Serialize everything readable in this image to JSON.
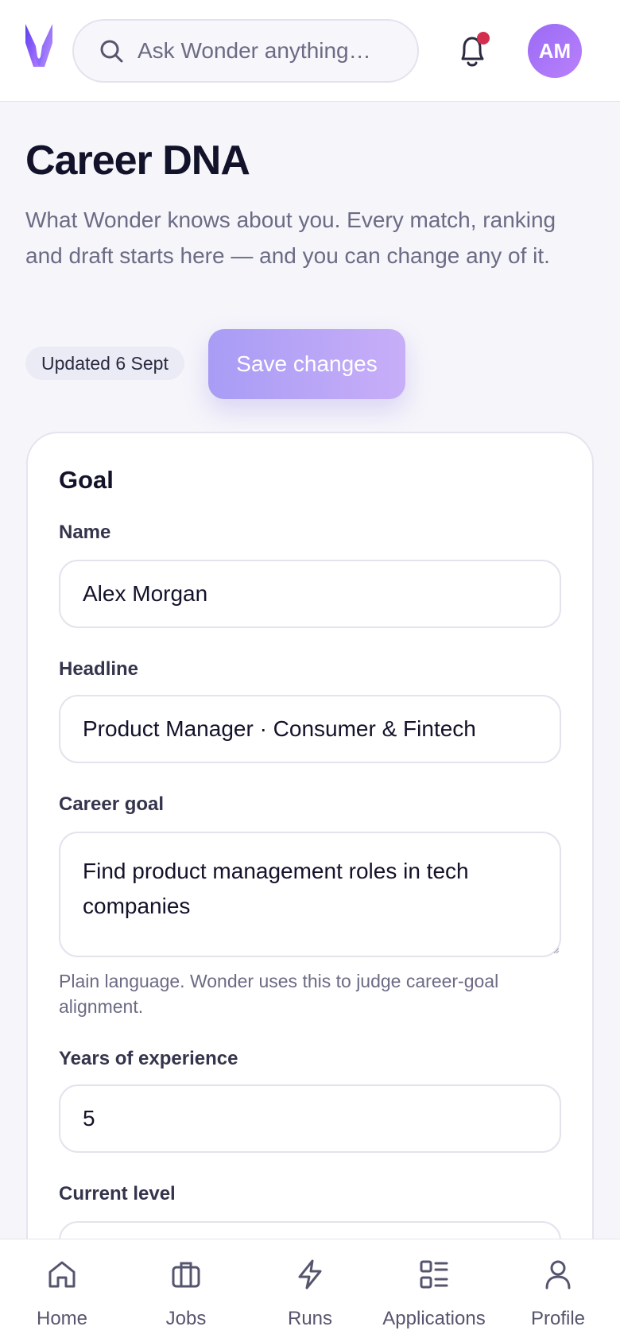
{
  "header": {
    "search_placeholder": "Ask Wonder anything…",
    "avatar_initials": "AM",
    "notification_dot_color": "#d32f4d",
    "brand_color": "#7c4dff"
  },
  "page": {
    "title": "Career DNA",
    "subtitle": "What Wonder knows about you. Every match, ranking and draft starts here — and you can change any of it.",
    "updated_label": "Updated 6 Sept",
    "save_label": "Save changes"
  },
  "form": {
    "section_title": "Goal",
    "name": {
      "label": "Name",
      "value": "Alex Morgan"
    },
    "headline": {
      "label": "Headline",
      "value": "Product Manager · Consumer & Fintech"
    },
    "career_goal": {
      "label": "Career goal",
      "value": "Find product management roles in tech companies",
      "hint": "Plain language. Wonder uses this to judge career-goal alignment."
    },
    "years": {
      "label": "Years of experience",
      "value": "5"
    },
    "current_level": {
      "label": "Current level"
    }
  },
  "nav": {
    "items": [
      {
        "label": "Home",
        "icon": "home-icon"
      },
      {
        "label": "Jobs",
        "icon": "briefcase-icon"
      },
      {
        "label": "Runs",
        "icon": "lightning-icon"
      },
      {
        "label": "Applications",
        "icon": "list-icon"
      },
      {
        "label": "Profile",
        "icon": "user-icon"
      }
    ]
  }
}
